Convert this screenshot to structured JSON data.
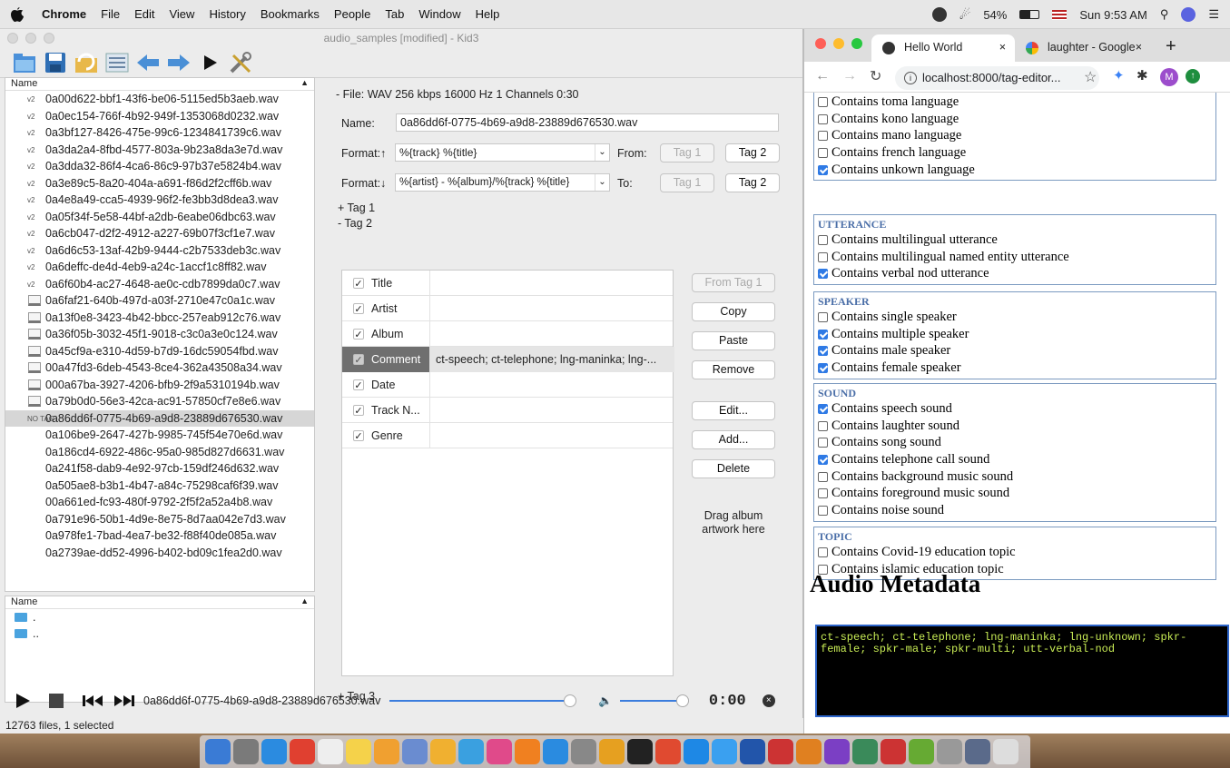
{
  "menubar": {
    "app": "Chrome",
    "items": [
      "File",
      "Edit",
      "View",
      "History",
      "Bookmarks",
      "People",
      "Tab",
      "Window",
      "Help"
    ],
    "battery": "54%",
    "clock": "Sun 9:53 AM"
  },
  "kid3": {
    "title": "audio_samples [modified] - Kid3",
    "filelist_header": "Name",
    "files": [
      {
        "name": "0a00d622-bbf1-43f6-be06-5115ed5b3aeb.wav",
        "icon": "v2"
      },
      {
        "name": "0a0ec154-766f-4b92-949f-1353068d0232.wav",
        "icon": "v2"
      },
      {
        "name": "0a3bf127-8426-475e-99c6-1234841739c6.wav",
        "icon": "v2"
      },
      {
        "name": "0a3da2a4-8fbd-4577-803a-9b23a8da3e7d.wav",
        "icon": "v2"
      },
      {
        "name": "0a3dda32-86f4-4ca6-86c9-97b37e5824b4.wav",
        "icon": "v2"
      },
      {
        "name": "0a3e89c5-8a20-404a-a691-f86d2f2cff6b.wav",
        "icon": "v2"
      },
      {
        "name": "0a4e8a49-cca5-4939-96f2-fe3bb3d8dea3.wav",
        "icon": "v2"
      },
      {
        "name": "0a05f34f-5e58-44bf-a2db-6eabe06dbc63.wav",
        "icon": "v2"
      },
      {
        "name": "0a6cb047-d2f2-4912-a227-69b07f3cf1e7.wav",
        "icon": "v2"
      },
      {
        "name": "0a6d6c53-13af-42b9-9444-c2b7533deb3c.wav",
        "icon": "v2"
      },
      {
        "name": "0a6deffc-de4d-4eb9-a24c-1accf1c8ff82.wav",
        "icon": "v2"
      },
      {
        "name": "0a6f60b4-ac27-4648-ae0c-cdb7899da0c7.wav",
        "icon": "v2"
      },
      {
        "name": "0a6faf21-640b-497d-a03f-2710e47c0a1c.wav",
        "icon": "doc"
      },
      {
        "name": "0a13f0e8-3423-4b42-bbcc-257eab912c76.wav",
        "icon": "doc"
      },
      {
        "name": "0a36f05b-3032-45f1-9018-c3c0a3e0c124.wav",
        "icon": "doc"
      },
      {
        "name": "0a45cf9a-e310-4d59-b7d9-16dc59054fbd.wav",
        "icon": "doc"
      },
      {
        "name": "00a47fd3-6deb-4543-8ce4-362a43508a34.wav",
        "icon": "doc"
      },
      {
        "name": "000a67ba-3927-4206-bfb9-2f9a5310194b.wav",
        "icon": "doc"
      },
      {
        "name": "0a79b0d0-56e3-42ca-ac91-57850cf7e8e6.wav",
        "icon": "doc"
      },
      {
        "name": "0a86dd6f-0775-4b69-a9d8-23889d676530.wav",
        "icon": "NO TAG",
        "selected": true
      },
      {
        "name": "0a106be9-2647-427b-9985-745f54e70e6d.wav",
        "icon": ""
      },
      {
        "name": "0a186cd4-6922-486c-95a0-985d827d6631.wav",
        "icon": ""
      },
      {
        "name": "0a241f58-dab9-4e92-97cb-159df246d632.wav",
        "icon": ""
      },
      {
        "name": "0a505ae8-b3b1-4b47-a84c-75298caf6f39.wav",
        "icon": ""
      },
      {
        "name": "00a661ed-fc93-480f-9792-2f5f2a52a4b8.wav",
        "icon": ""
      },
      {
        "name": "0a791e96-50b1-4d9e-8e75-8d7aa042e7d3.wav",
        "icon": ""
      },
      {
        "name": "0a978fe1-7bad-4ea7-be32-f88f40de085a.wav",
        "icon": ""
      },
      {
        "name": "0a2739ae-dd52-4996-b402-bd09c1fea2d0.wav",
        "icon": ""
      }
    ],
    "dirlist_header": "Name",
    "dirs": [
      ".",
      ".."
    ],
    "file_info": "- File: WAV 256 kbps 16000 Hz 1 Channels 0:30",
    "name_label": "Name:",
    "name_value": "0a86dd6f-0775-4b69-a9d8-23889d676530.wav",
    "format_up_label": "Format:↑",
    "format_up_value": "%{track} %{title}",
    "from_label": "From:",
    "format_down_label": "Format:↓",
    "format_down_value": "%{artist} - %{album}/%{track} %{title}",
    "to_label": "To:",
    "tag1_btn": "Tag 1",
    "tag2_btn": "Tag 2",
    "tag1_section": "+ Tag 1",
    "tag2_section": "- Tag 2",
    "tag3_section": "+ Tag 3",
    "frames": [
      {
        "name": "Title",
        "value": "",
        "checked": true
      },
      {
        "name": "Artist",
        "value": "",
        "checked": true
      },
      {
        "name": "Album",
        "value": "",
        "checked": true
      },
      {
        "name": "Comment",
        "value": "ct-speech; ct-telephone; lng-maninka; lng-...",
        "checked": true,
        "highlight": true
      },
      {
        "name": "Date",
        "value": "",
        "checked": true
      },
      {
        "name": "Track N...",
        "value": "",
        "checked": true
      },
      {
        "name": "Genre",
        "value": "",
        "checked": true
      }
    ],
    "buttons": {
      "from_tag1": "From Tag 1",
      "copy": "Copy",
      "paste": "Paste",
      "remove": "Remove",
      "edit": "Edit...",
      "add": "Add...",
      "delete": "Delete"
    },
    "drag_artwork": "Drag album artwork here",
    "player_file": "0a86dd6f-0775-4b69-a9d8-23889d676530.wav",
    "player_time": "0:00",
    "status": "12763 files, 1 selected"
  },
  "chrome": {
    "tabs": [
      {
        "title": "Hello World",
        "active": true
      },
      {
        "title": "laughter - Google"
      }
    ],
    "url": "localhost:8000/tag-editor...",
    "profile_initial": "M",
    "partial_top": "Contains upcle language",
    "lang_items": [
      {
        "label": "Contains toma language",
        "checked": false
      },
      {
        "label": "Contains kono language",
        "checked": false
      },
      {
        "label": "Contains mano language",
        "checked": false
      },
      {
        "label": "Contains french language",
        "checked": false
      },
      {
        "label": "Contains unkown language",
        "checked": true
      }
    ],
    "groups": [
      {
        "legend": "Utterance",
        "items": [
          {
            "label": "Contains multilingual utterance",
            "checked": false
          },
          {
            "label": "Contains multilingual named entity utterance",
            "checked": false
          },
          {
            "label": "Contains verbal nod utterance",
            "checked": true
          }
        ]
      },
      {
        "legend": "Speaker",
        "items": [
          {
            "label": "Contains single speaker",
            "checked": false
          },
          {
            "label": "Contains multiple speaker",
            "checked": true
          },
          {
            "label": "Contains male speaker",
            "checked": true
          },
          {
            "label": "Contains female speaker",
            "checked": true
          }
        ]
      },
      {
        "legend": "Sound",
        "items": [
          {
            "label": "Contains speech sound",
            "checked": true
          },
          {
            "label": "Contains laughter sound",
            "checked": false
          },
          {
            "label": "Contains song sound",
            "checked": false
          },
          {
            "label": "Contains telephone call sound",
            "checked": true
          },
          {
            "label": "Contains background music sound",
            "checked": false
          },
          {
            "label": "Contains foreground music sound",
            "checked": false
          },
          {
            "label": "Contains noise sound",
            "checked": false
          }
        ]
      },
      {
        "legend": "Topic",
        "items": [
          {
            "label": "Contains Covid-19 education topic",
            "checked": false
          },
          {
            "label": "Contains islamic education topic",
            "checked": false
          }
        ]
      }
    ],
    "heading": "Audio Metadata",
    "metadata_text": "ct-speech; ct-telephone; lng-maninka; lng-unknown; spkr-female; spkr-male; spkr-multi; utt-verbal-nod"
  }
}
